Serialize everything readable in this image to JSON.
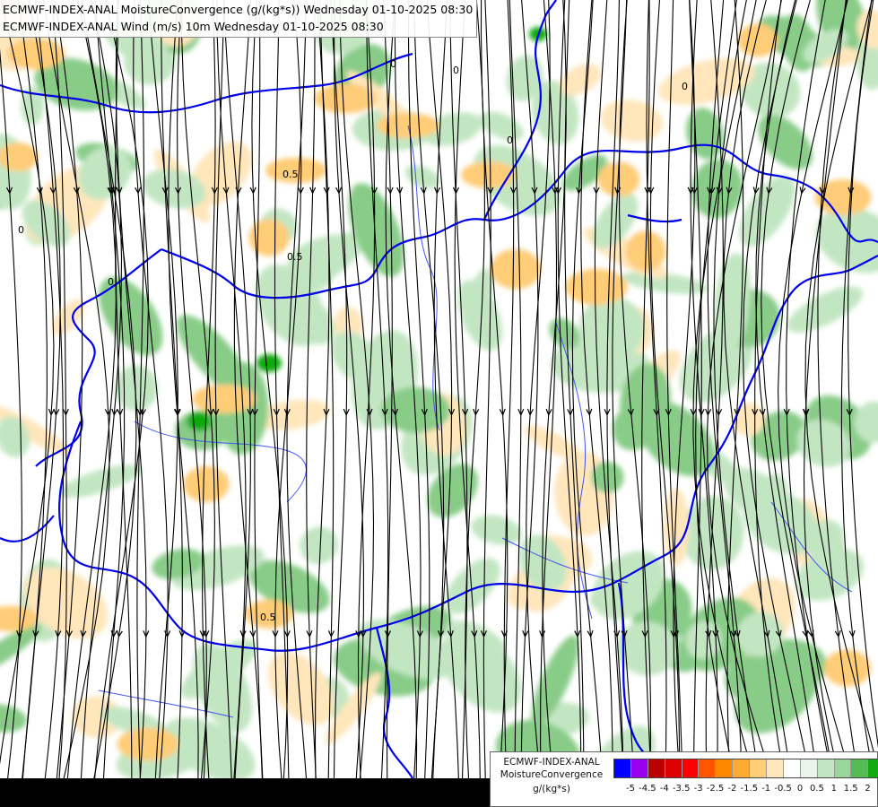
{
  "header": {
    "line1": "ECMWF-INDEX-ANAL MoistureConvergence (g/(kg*s)) Wednesday 01-10-2025 08:30",
    "line2": "ECMWF-INDEX-ANAL Wind (m/s) 10m Wednesday 01-10-2025 08:30"
  },
  "legend": {
    "model": "ECMWF-INDEX-ANAL",
    "parameter": "MoistureConvergence",
    "unit": "g/(kg*s)",
    "colors": [
      "#0000ff",
      "#9900ee",
      "#bb0000",
      "#dd0000",
      "#ff0000",
      "#ff5500",
      "#ff8800",
      "#ffaa33",
      "#ffcc77",
      "#ffe6bb",
      "#ffffff",
      "#e8f5e8",
      "#c2e6c2",
      "#99d699",
      "#55bb55",
      "#11aa11"
    ],
    "ticks": [
      "-5",
      "-4.5",
      "-4",
      "-3.5",
      "-3",
      "-2.5",
      "-2",
      "-1.5",
      "-1",
      "-0.5",
      "0",
      "0.5",
      "1",
      "1.5",
      "2"
    ]
  },
  "map": {
    "contour_labels": [
      "0.5",
      "0.5",
      "0.5",
      "0",
      "0",
      "0",
      "0",
      "0",
      "0"
    ],
    "colors": {
      "border": "#0000ee",
      "river": "#4455ee",
      "streamline": "#000000",
      "convergence_light": "#c2e6c2",
      "convergence_mid": "#88cc88",
      "convergence_strong": "#11aa11",
      "divergence_light": "#ffe6bb",
      "divergence_mid": "#ffcc77"
    }
  }
}
